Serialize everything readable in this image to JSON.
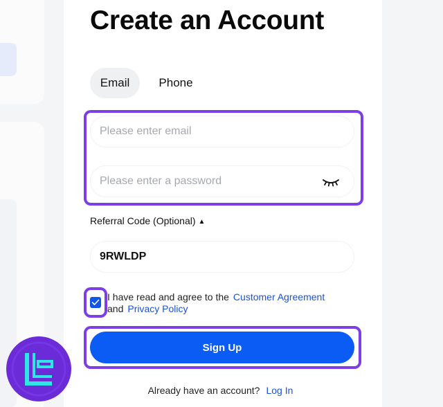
{
  "title": "Create an Account",
  "tabs": [
    {
      "label": "Email",
      "active": true
    },
    {
      "label": "Phone",
      "active": false
    }
  ],
  "form": {
    "email_placeholder": "Please enter email",
    "password_placeholder": "Please enter a password",
    "referral_label": "Referral Code (Optional)",
    "referral_caret": "▲",
    "referral_value": "9RWLDP"
  },
  "agreement": {
    "checked": true,
    "prefix": "I have read and agree to the",
    "customer_agreement": "Customer Agreement",
    "and": "and",
    "privacy_policy": "Privacy Policy"
  },
  "signup_label": "Sign Up",
  "login": {
    "prompt": "Already have an account?",
    "link": "Log In"
  },
  "colors": {
    "accent": "#0b5bf5",
    "link": "#1753d8",
    "highlight": "#7b3fe4",
    "logo_bg": "#6b2bd6",
    "logo_mark": "#2ee6e6"
  },
  "icons": {
    "password_toggle": "eye-closed-icon",
    "checkbox_mark": "checkmark-icon",
    "brand": "brand-logo"
  }
}
